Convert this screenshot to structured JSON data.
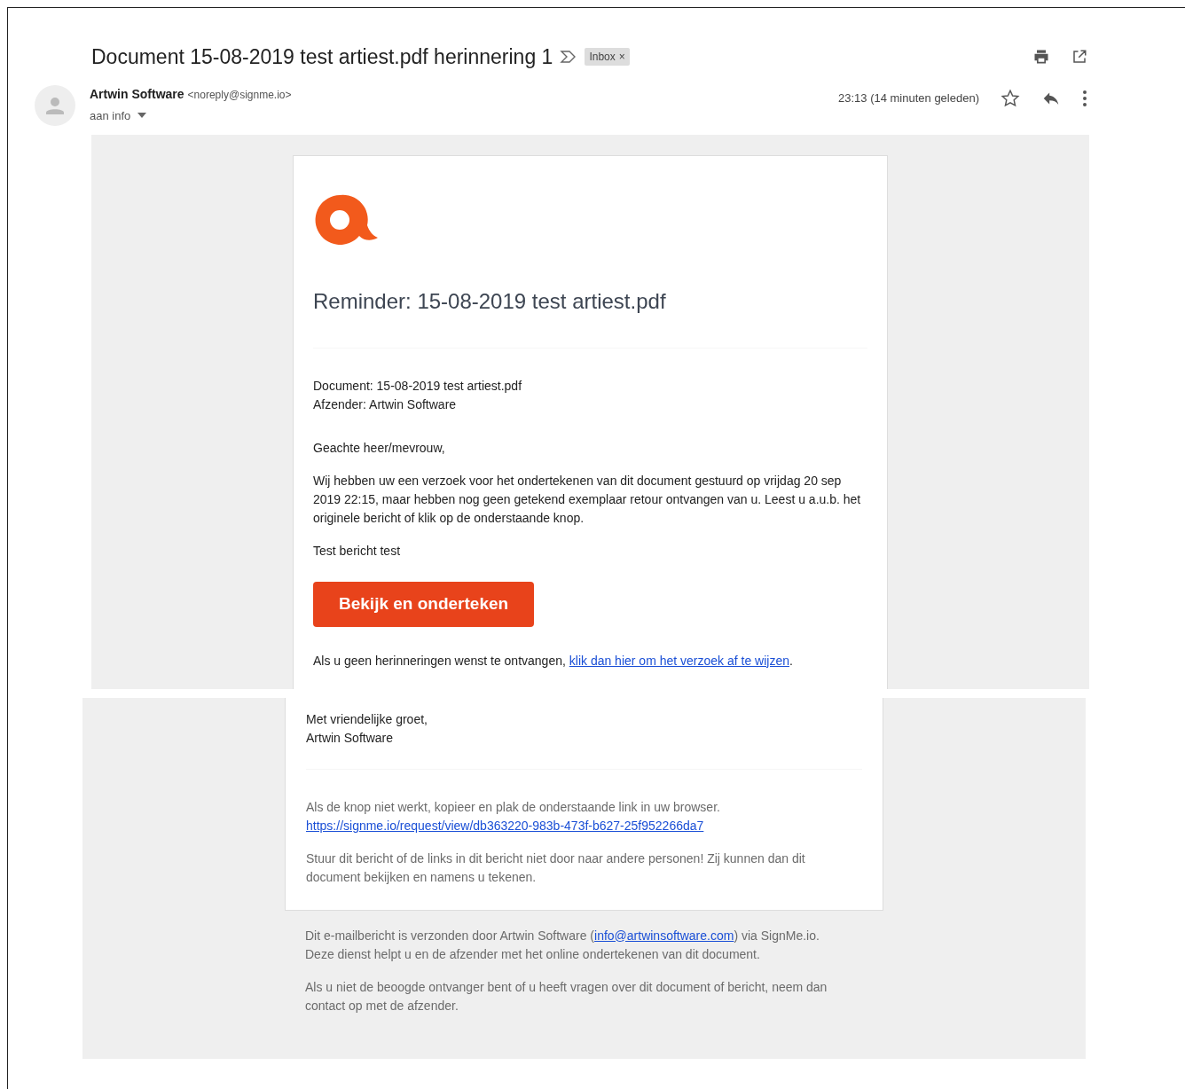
{
  "email": {
    "subject": "Document 15-08-2019 test artiest.pdf herinnering 1",
    "label": "Inbox",
    "label_remove": "×",
    "sender_name": "Artwin Software",
    "sender_email": "<noreply@signme.io>",
    "recipient": "aan info",
    "time": "23:13 (14 minuten geleden)"
  },
  "message_top": {
    "heading": "Reminder: 15-08-2019 test artiest.pdf",
    "document_line": "Document: 15-08-2019 test artiest.pdf",
    "sender_line": "Afzender: Artwin Software",
    "greeting": "Geachte heer/mevrouw,",
    "body": "Wij hebben uw een verzoek voor het ondertekenen van dit document gestuurd op vrijdag 20 sep 2019 22:15, maar hebben nog geen getekend exemplaar retour ontvangen van u. Leest u a.u.b. het originele bericht of klik op de onderstaande knop.",
    "note": "Test bericht test",
    "button": "Bekijk en onderteken",
    "unsubscribe": {
      "before": "Als u geen herinneringen wenst te ontvangen, ",
      "link": "klik dan hier om het verzoek af te wijzen",
      "after": "."
    }
  },
  "message_bottom": {
    "closing": "Met vriendelijke groet,",
    "signature": "Artwin Software",
    "fallback_text": "Als de knop niet werkt, kopieer en plak de onderstaande link in uw browser.",
    "fallback_link": "https://signme.io/request/view/db363220-983b-473f-b627-25f952266da7",
    "warning": "Stuur dit bericht of de links in dit bericht niet door naar andere personen! Zij kunnen dan dit document bekijken en namens u tekenen."
  },
  "footer": {
    "sent_by": {
      "before": "Dit e-mailbericht is verzonden door Artwin Software (",
      "link": "info@artwinsoftware.com",
      "after": ") via SignMe.io."
    },
    "service": "Deze dienst helpt u en de afzender met het online ondertekenen van dit document.",
    "contact": "Als u niet de beoogde ontvanger bent of u heeft vragen over dit document of bericht, neem dan contact op met de afzender."
  }
}
